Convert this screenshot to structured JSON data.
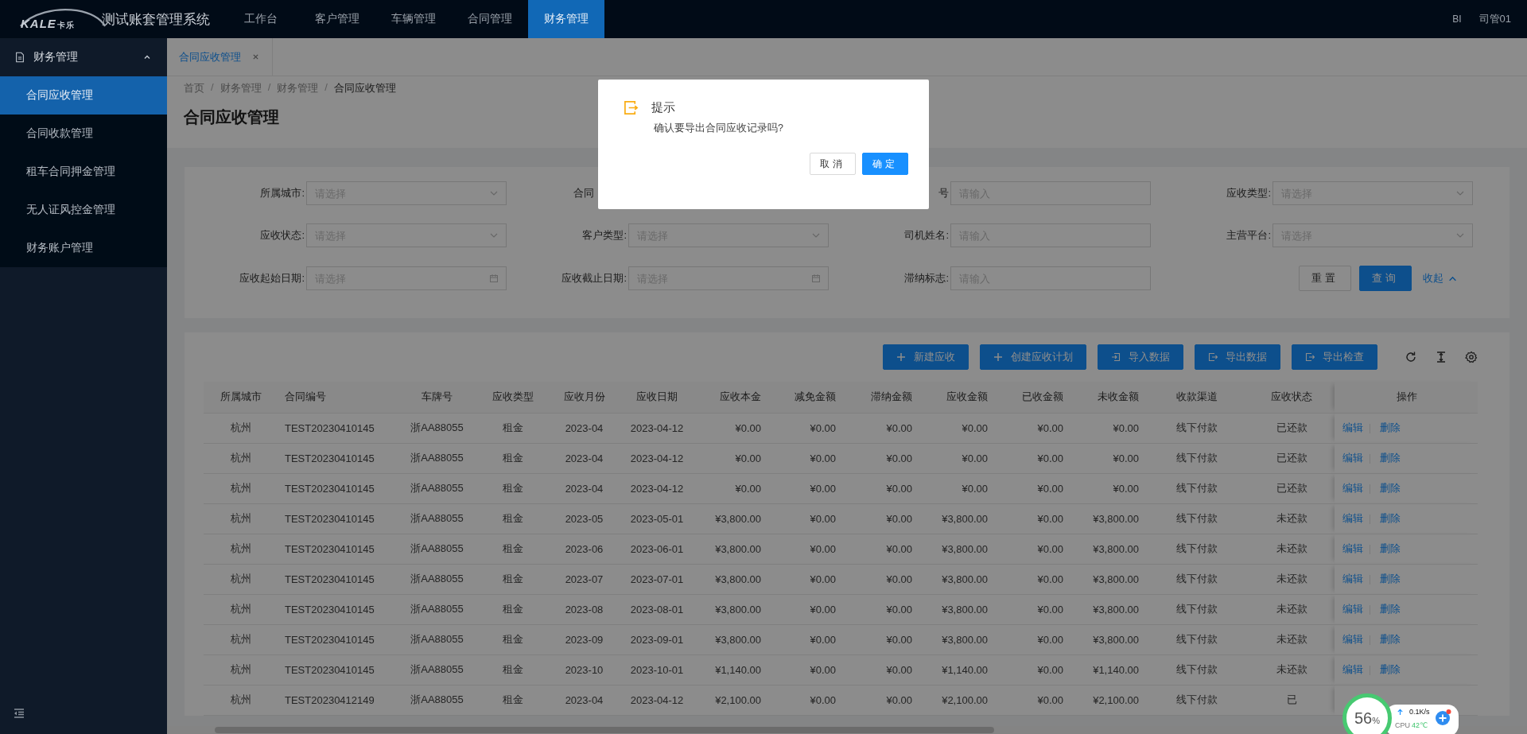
{
  "app": {
    "logo_text": "KALE",
    "logo_text_cn": "卡乐",
    "title": "测试账套管理系统"
  },
  "top_nav": [
    {
      "label": "工作台",
      "selected": false
    },
    {
      "label": "客户管理",
      "selected": false
    },
    {
      "label": "车辆管理",
      "selected": false
    },
    {
      "label": "合同管理",
      "selected": false
    },
    {
      "label": "财务管理",
      "selected": true
    }
  ],
  "user_menu": {
    "bi": "BI",
    "user": "司管01"
  },
  "sidebar": {
    "group": {
      "label": "财务管理",
      "expanded": true
    },
    "items": [
      {
        "label": "合同应收管理",
        "selected": true
      },
      {
        "label": "合同收款管理",
        "selected": false
      },
      {
        "label": "租车合同押金管理",
        "selected": false
      },
      {
        "label": "无人证风控金管理",
        "selected": false
      },
      {
        "label": "财务账户管理",
        "selected": false
      }
    ]
  },
  "tabs": [
    {
      "label": "合同应收管理",
      "selected": true
    }
  ],
  "breadcrumb": {
    "separator": "/",
    "items": [
      "首页",
      "财务管理",
      "财务管理",
      "合同应收管理"
    ]
  },
  "page_title": "合同应收管理",
  "filters": [
    {
      "label": "所属城市:",
      "kind": "select",
      "placeholder": "请选择"
    },
    {
      "label": "合同",
      "kind": "covered"
    },
    {
      "label": "号",
      "kind": "input",
      "placeholder": "请输入"
    },
    {
      "label": "应收类型:",
      "kind": "select",
      "placeholder": "请选择"
    },
    {
      "label": "应收状态:",
      "kind": "select",
      "placeholder": "请选择"
    },
    {
      "label": "客户类型:",
      "kind": "select",
      "placeholder": "请选择"
    },
    {
      "label": "司机姓名:",
      "kind": "input",
      "placeholder": "请输入"
    },
    {
      "label": "主营平台:",
      "kind": "select",
      "placeholder": "请选择"
    },
    {
      "label": "应收起始日期:",
      "kind": "date",
      "placeholder": "请选择"
    },
    {
      "label": "应收截止日期:",
      "kind": "date",
      "placeholder": "请选择"
    },
    {
      "label": "滞纳标志:",
      "kind": "input",
      "placeholder": "请输入"
    }
  ],
  "filter_actions": {
    "reset": "重置",
    "search": "查询",
    "collapse": "收起",
    "expanded": true
  },
  "toolbar": [
    {
      "label": "新建应收",
      "kind": "plus"
    },
    {
      "label": "创建应收计划",
      "kind": "plus"
    },
    {
      "label": "导入数据",
      "kind": "import"
    },
    {
      "label": "导出数据",
      "kind": "export"
    },
    {
      "label": "导出检查",
      "kind": "export"
    }
  ],
  "table": {
    "columns": [
      "所属城市",
      "合同编号",
      "车牌号",
      "应收类型",
      "应收月份",
      "应收日期",
      "应收本金",
      "减免金额",
      "滞纳金额",
      "应收金额",
      "已收金额",
      "未收金额",
      "收款渠道",
      "应收状态",
      "操作"
    ],
    "rows": [
      {
        "cells": [
          "杭州",
          "TEST20230410145",
          "浙AA88055",
          "租金",
          "2023-04",
          "2023-04-12",
          "¥0.00",
          "¥0.00",
          "¥0.00",
          "¥0.00",
          "¥0.00",
          "¥0.00",
          "线下付款",
          "已还款"
        ],
        "actions": [
          "编辑",
          "删除"
        ]
      },
      {
        "cells": [
          "杭州",
          "TEST20230410145",
          "浙AA88055",
          "租金",
          "2023-04",
          "2023-04-12",
          "¥0.00",
          "¥0.00",
          "¥0.00",
          "¥0.00",
          "¥0.00",
          "¥0.00",
          "线下付款",
          "已还款"
        ],
        "actions": [
          "编辑",
          "删除"
        ]
      },
      {
        "cells": [
          "杭州",
          "TEST20230410145",
          "浙AA88055",
          "租金",
          "2023-04",
          "2023-04-12",
          "¥0.00",
          "¥0.00",
          "¥0.00",
          "¥0.00",
          "¥0.00",
          "¥0.00",
          "线下付款",
          "已还款"
        ],
        "actions": [
          "编辑",
          "删除"
        ]
      },
      {
        "cells": [
          "杭州",
          "TEST20230410145",
          "浙AA88055",
          "租金",
          "2023-05",
          "2023-05-01",
          "¥3,800.00",
          "¥0.00",
          "¥0.00",
          "¥3,800.00",
          "¥0.00",
          "¥3,800.00",
          "线下付款",
          "未还款"
        ],
        "actions": [
          "编辑",
          "删除"
        ]
      },
      {
        "cells": [
          "杭州",
          "TEST20230410145",
          "浙AA88055",
          "租金",
          "2023-06",
          "2023-06-01",
          "¥3,800.00",
          "¥0.00",
          "¥0.00",
          "¥3,800.00",
          "¥0.00",
          "¥3,800.00",
          "线下付款",
          "未还款"
        ],
        "actions": [
          "编辑",
          "删除"
        ]
      },
      {
        "cells": [
          "杭州",
          "TEST20230410145",
          "浙AA88055",
          "租金",
          "2023-07",
          "2023-07-01",
          "¥3,800.00",
          "¥0.00",
          "¥0.00",
          "¥3,800.00",
          "¥0.00",
          "¥3,800.00",
          "线下付款",
          "未还款"
        ],
        "actions": [
          "编辑",
          "删除"
        ]
      },
      {
        "cells": [
          "杭州",
          "TEST20230410145",
          "浙AA88055",
          "租金",
          "2023-08",
          "2023-08-01",
          "¥3,800.00",
          "¥0.00",
          "¥0.00",
          "¥3,800.00",
          "¥0.00",
          "¥3,800.00",
          "线下付款",
          "未还款"
        ],
        "actions": [
          "编辑",
          "删除"
        ]
      },
      {
        "cells": [
          "杭州",
          "TEST20230410145",
          "浙AA88055",
          "租金",
          "2023-09",
          "2023-09-01",
          "¥3,800.00",
          "¥0.00",
          "¥0.00",
          "¥3,800.00",
          "¥0.00",
          "¥3,800.00",
          "线下付款",
          "未还款"
        ],
        "actions": [
          "编辑",
          "删除"
        ]
      },
      {
        "cells": [
          "杭州",
          "TEST20230410145",
          "浙AA88055",
          "租金",
          "2023-10",
          "2023-10-01",
          "¥1,140.00",
          "¥0.00",
          "¥0.00",
          "¥1,140.00",
          "¥0.00",
          "¥1,140.00",
          "线下付款",
          "未还款"
        ],
        "actions": [
          "编辑",
          "删除"
        ]
      },
      {
        "cells": [
          "杭州",
          "TEST20230412149",
          "浙AA88055",
          "租金",
          "2023-04",
          "2023-04-12",
          "¥2,100.00",
          "¥0.00",
          "¥0.00",
          "¥2,100.00",
          "¥0.00",
          "¥2,100.00",
          "线下付款",
          "已"
        ]
      }
    ]
  },
  "dialog": {
    "title": "提示",
    "message": "确认要导出合同应收记录吗?",
    "cancel": "取消",
    "confirm": "确定"
  },
  "system_widget": {
    "percent": "56",
    "unit": "%",
    "speed": "0.1K/s",
    "cpu_label": "CPU",
    "cpu_temp": "42℃"
  }
}
